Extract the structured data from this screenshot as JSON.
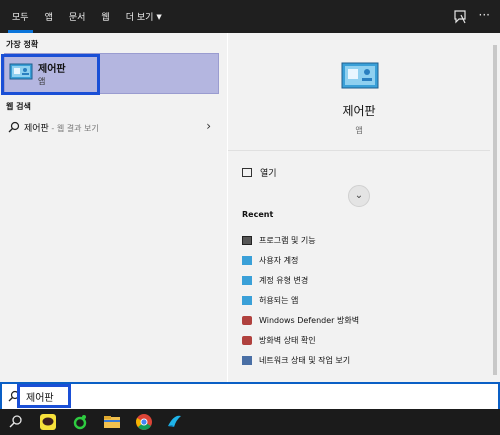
{
  "filters": {
    "tabs": [
      {
        "label": "모두"
      },
      {
        "label": "앱"
      },
      {
        "label": "문서"
      },
      {
        "label": "웹"
      },
      {
        "label": "더 보기"
      }
    ],
    "more_dots": "···"
  },
  "left": {
    "best_match_heading": "가장 정확",
    "best_match": {
      "title": "제어판",
      "subtitle": "앱"
    },
    "web_heading": "웹 검색",
    "web_result": {
      "query": "제어판",
      "suffix": " - 웹 결과 보기",
      "chevron": "›"
    }
  },
  "right": {
    "title": "제어판",
    "subtitle": "앱",
    "open_label": "열기",
    "expand_glyph": "⌄",
    "recent_heading": "Recent",
    "recent": [
      {
        "label": "프로그램 및 기능",
        "icon": "programs-icon"
      },
      {
        "label": "사용자 계정",
        "icon": "user-accounts-icon"
      },
      {
        "label": "계정 유형 변경",
        "icon": "account-type-icon"
      },
      {
        "label": "허용되는 앱",
        "icon": "allowed-apps-icon"
      },
      {
        "label": "Windows Defender 방화벽",
        "icon": "firewall-icon"
      },
      {
        "label": "방화벽 상태 확인",
        "icon": "firewall-status-icon"
      },
      {
        "label": "네트워크 상태 및 작업 보기",
        "icon": "network-icon"
      }
    ]
  },
  "search": {
    "value": "제어판"
  },
  "colors": {
    "accent": "#0a74da",
    "highlight_box": "#1a4fd6",
    "selected_bg": "#b4b6e0"
  }
}
